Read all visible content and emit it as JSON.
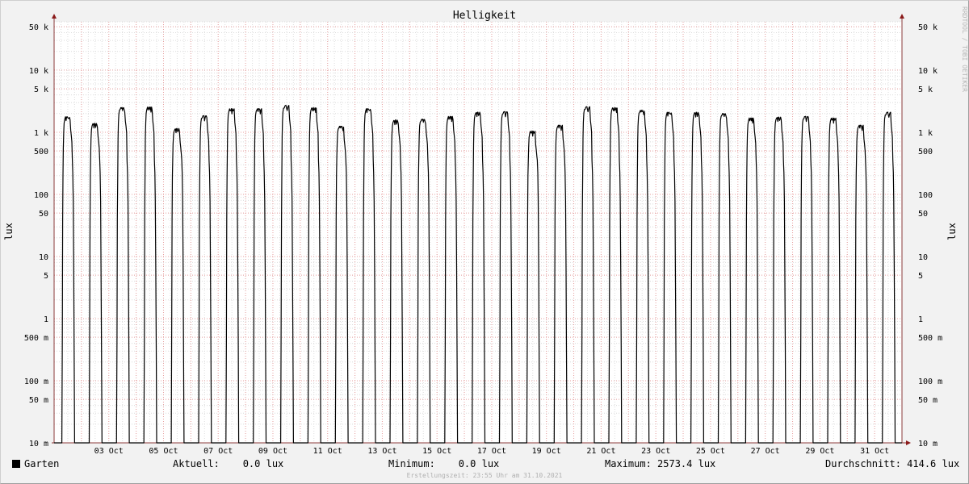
{
  "chart_data": {
    "type": "line",
    "title": "Helligkeit",
    "ylabel": "lux",
    "yscale": "log",
    "ylim": [
      0.01,
      60000
    ],
    "y_ticks": [
      {
        "value": 0.01,
        "label": "10 m"
      },
      {
        "value": 0.05,
        "label": "50 m"
      },
      {
        "value": 0.1,
        "label": "100 m"
      },
      {
        "value": 0.5,
        "label": "500 m"
      },
      {
        "value": 1,
        "label": "1"
      },
      {
        "value": 5,
        "label": "5"
      },
      {
        "value": 10,
        "label": "10"
      },
      {
        "value": 50,
        "label": "50"
      },
      {
        "value": 100,
        "label": "100"
      },
      {
        "value": 500,
        "label": "500"
      },
      {
        "value": 1000,
        "label": "1 k"
      },
      {
        "value": 5000,
        "label": "5 k"
      },
      {
        "value": 10000,
        "label": "10 k"
      },
      {
        "value": 50000,
        "label": "50 k"
      }
    ],
    "x_range": [
      "2021-10-01",
      "2021-11-01"
    ],
    "x_ticks": [
      "03 Oct",
      "05 Oct",
      "07 Oct",
      "09 Oct",
      "11 Oct",
      "13 Oct",
      "15 Oct",
      "17 Oct",
      "19 Oct",
      "21 Oct",
      "23 Oct",
      "25 Oct",
      "27 Oct",
      "29 Oct",
      "31 Oct"
    ],
    "grid": true,
    "series": [
      {
        "name": "Garten",
        "color": "#000000",
        "daily_peak_lux": [
          1780,
          1400,
          2500,
          2550,
          1150,
          1850,
          2400,
          2400,
          2700,
          2500,
          1250,
          2400,
          1580,
          1620,
          1800,
          2100,
          2150,
          1050,
          1300,
          2573.4,
          2500,
          2250,
          2100,
          2100,
          2000,
          1700,
          1750,
          1800,
          1700,
          1300,
          2100
        ]
      }
    ]
  },
  "legend": {
    "series_name": "Garten",
    "current": "Aktuell:    0.0 lux",
    "minimum": "Minimum:    0.0 lux",
    "maximum": "Maximum: 2573.4 lux",
    "average": "Durchschnitt: 414.6 lux"
  },
  "footer": "Erstellungszeit: 23:55 Uhr am 31.10.2021",
  "watermark": "RRDTOOL / TOBI OETIKER"
}
